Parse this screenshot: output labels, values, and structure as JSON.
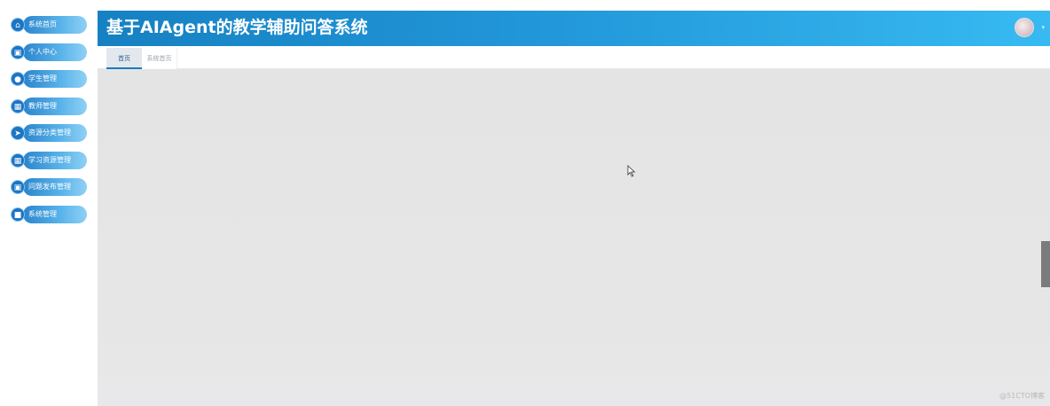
{
  "header": {
    "title": "基于AIAgent的教学辅助问答系统",
    "caret": "▾"
  },
  "sidebar": {
    "items": [
      {
        "label": "系统首页",
        "icon": "home-icon",
        "glyph": "⌂"
      },
      {
        "label": "个人中心",
        "icon": "user-card-icon",
        "glyph": "▣"
      },
      {
        "label": "学生管理",
        "icon": "person-icon",
        "glyph": "●"
      },
      {
        "label": "教师管理",
        "icon": "grid-icon",
        "glyph": "▦"
      },
      {
        "label": "资源分类管理",
        "icon": "send-icon",
        "glyph": "➤"
      },
      {
        "label": "学习资源管理",
        "icon": "grid-icon",
        "glyph": "▦"
      },
      {
        "label": "问题发布管理",
        "icon": "clipboard-icon",
        "glyph": "▣"
      },
      {
        "label": "系统管理",
        "icon": "square-icon",
        "glyph": "■"
      }
    ]
  },
  "tabs": [
    {
      "label": "首页",
      "active": true
    },
    {
      "label": "系统首页",
      "active": false
    }
  ],
  "watermark": "@51CTO博客",
  "colors": {
    "header_start": "#1681c2",
    "header_end": "#37baf2",
    "nav_pill": "#2a84cc",
    "content_bg": "#e4e4e4"
  }
}
